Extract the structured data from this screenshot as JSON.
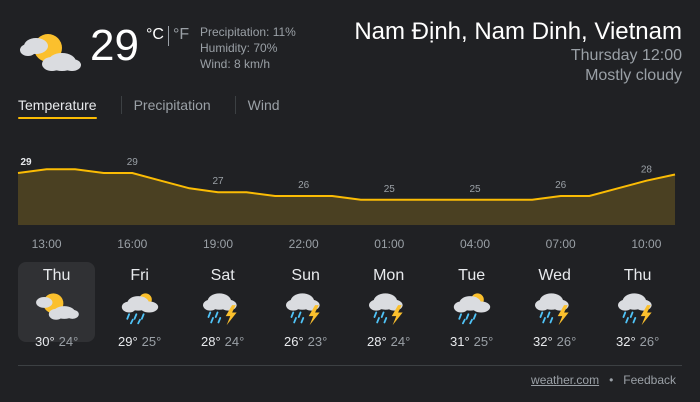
{
  "current": {
    "temp": "29",
    "unit_c": "°C",
    "unit_f": "°F",
    "icon": "mostly-cloudy-sun-icon",
    "precipitation": "Precipitation: 11%",
    "humidity": "Humidity: 70%",
    "wind": "Wind: 8 km/h"
  },
  "location": {
    "city": "Nam Định, Nam Dinh, Vietnam",
    "datetime": "Thursday 12:00",
    "condition": "Mostly cloudy"
  },
  "tabs": [
    "Temperature",
    "Precipitation",
    "Wind"
  ],
  "active_tab": "Temperature",
  "colors": {
    "accent": "#fbbc04",
    "fill": "#4a4022",
    "bg": "#202124"
  },
  "chart_data": {
    "type": "area",
    "x": [
      "12:00",
      "13:00",
      "14:00",
      "15:00",
      "16:00",
      "17:00",
      "18:00",
      "19:00",
      "20:00",
      "21:00",
      "22:00",
      "23:00",
      "00:00",
      "01:00",
      "02:00",
      "03:00",
      "04:00",
      "05:00",
      "06:00",
      "07:00",
      "08:00",
      "09:00",
      "10:00",
      "11:00"
    ],
    "values": [
      29,
      29.5,
      29.5,
      29,
      29,
      28,
      27,
      26.5,
      26.5,
      26,
      26,
      26,
      25.5,
      25.5,
      25.5,
      25.5,
      25.5,
      25.5,
      25.5,
      26,
      26,
      27,
      28,
      28.8
    ],
    "labels": [
      {
        "hour": "12:00",
        "text": "29"
      },
      {
        "hour": "16:00",
        "text": "29"
      },
      {
        "hour": "19:00",
        "text": "27"
      },
      {
        "hour": "22:00",
        "text": "26"
      },
      {
        "hour": "01:00",
        "text": "25"
      },
      {
        "hour": "04:00",
        "text": "25"
      },
      {
        "hour": "07:00",
        "text": "26"
      },
      {
        "hour": "10:00",
        "text": "28"
      }
    ],
    "ticks": [
      "13:00",
      "16:00",
      "19:00",
      "22:00",
      "01:00",
      "04:00",
      "07:00",
      "10:00"
    ],
    "ylim": [
      23,
      32
    ]
  },
  "days": [
    {
      "name": "Thu",
      "icon": "mostly-cloudy-sun-icon",
      "hi": "30°",
      "lo": "24°"
    },
    {
      "name": "Fri",
      "icon": "showers-sun-icon",
      "hi": "29°",
      "lo": "25°"
    },
    {
      "name": "Sat",
      "icon": "thunderstorm-icon",
      "hi": "28°",
      "lo": "24°"
    },
    {
      "name": "Sun",
      "icon": "thunderstorm-icon",
      "hi": "26°",
      "lo": "23°"
    },
    {
      "name": "Mon",
      "icon": "thunderstorm-icon",
      "hi": "28°",
      "lo": "24°"
    },
    {
      "name": "Tue",
      "icon": "showers-sun-icon",
      "hi": "31°",
      "lo": "25°"
    },
    {
      "name": "Wed",
      "icon": "thunderstorm-icon",
      "hi": "32°",
      "lo": "26°"
    },
    {
      "name": "Thu",
      "icon": "thunderstorm-icon",
      "hi": "32°",
      "lo": "26°"
    }
  ],
  "footer": {
    "source": "weather.com",
    "separator": "•",
    "feedback": "Feedback"
  }
}
